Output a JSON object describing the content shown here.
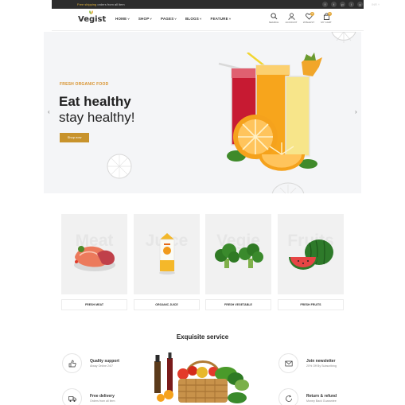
{
  "topbar": {
    "shipping_prefix": "Free shipping",
    "shipping_suffix": " orders from all item",
    "socials": [
      "f",
      "t",
      "p",
      "i",
      "y"
    ],
    "currency": "INR ˅"
  },
  "header": {
    "logo": "Vegist",
    "nav": [
      {
        "label": "HOME"
      },
      {
        "label": "SHOP"
      },
      {
        "label": "PAGES"
      },
      {
        "label": "BLOGS"
      },
      {
        "label": "FEATURE"
      }
    ],
    "icons": [
      {
        "name": "search-icon",
        "label": "SEARCH"
      },
      {
        "name": "user-icon",
        "label": "ACCOUNT"
      },
      {
        "name": "heart-icon",
        "label": "WISHLIST",
        "badge": "0"
      },
      {
        "name": "bag-icon",
        "label": "MY CART",
        "badge": "0"
      }
    ]
  },
  "hero": {
    "kicker": "FRESH ORGANIC FOOD",
    "title_line1": "Eat healthy",
    "title_line2": "stay healthy!",
    "button": "Shop now"
  },
  "categories": [
    {
      "bg_word": "Meat",
      "label": "FRESH MEAT"
    },
    {
      "bg_word": "Juice",
      "label": "ORGANIC JUICE"
    },
    {
      "bg_word": "Vegie",
      "label": "FRESH VEGETABLE"
    },
    {
      "bg_word": "Fruits",
      "label": "FRESH FRUITS"
    }
  ],
  "service": {
    "title": "Exquisite service",
    "items": [
      {
        "title": "Quality support",
        "subtitle": "Alway Online 24/7"
      },
      {
        "title": "Join newsletter",
        "subtitle": "20% Off By Subscribing"
      },
      {
        "title": "Free delivery",
        "subtitle": "Orders from all item"
      },
      {
        "title": "Return & refund",
        "subtitle": "Money Back Guarantee"
      }
    ]
  },
  "colors": {
    "accent": "#c8932c",
    "topbar": "#2c2c2c",
    "hero_bg": "#f4f5f7"
  }
}
